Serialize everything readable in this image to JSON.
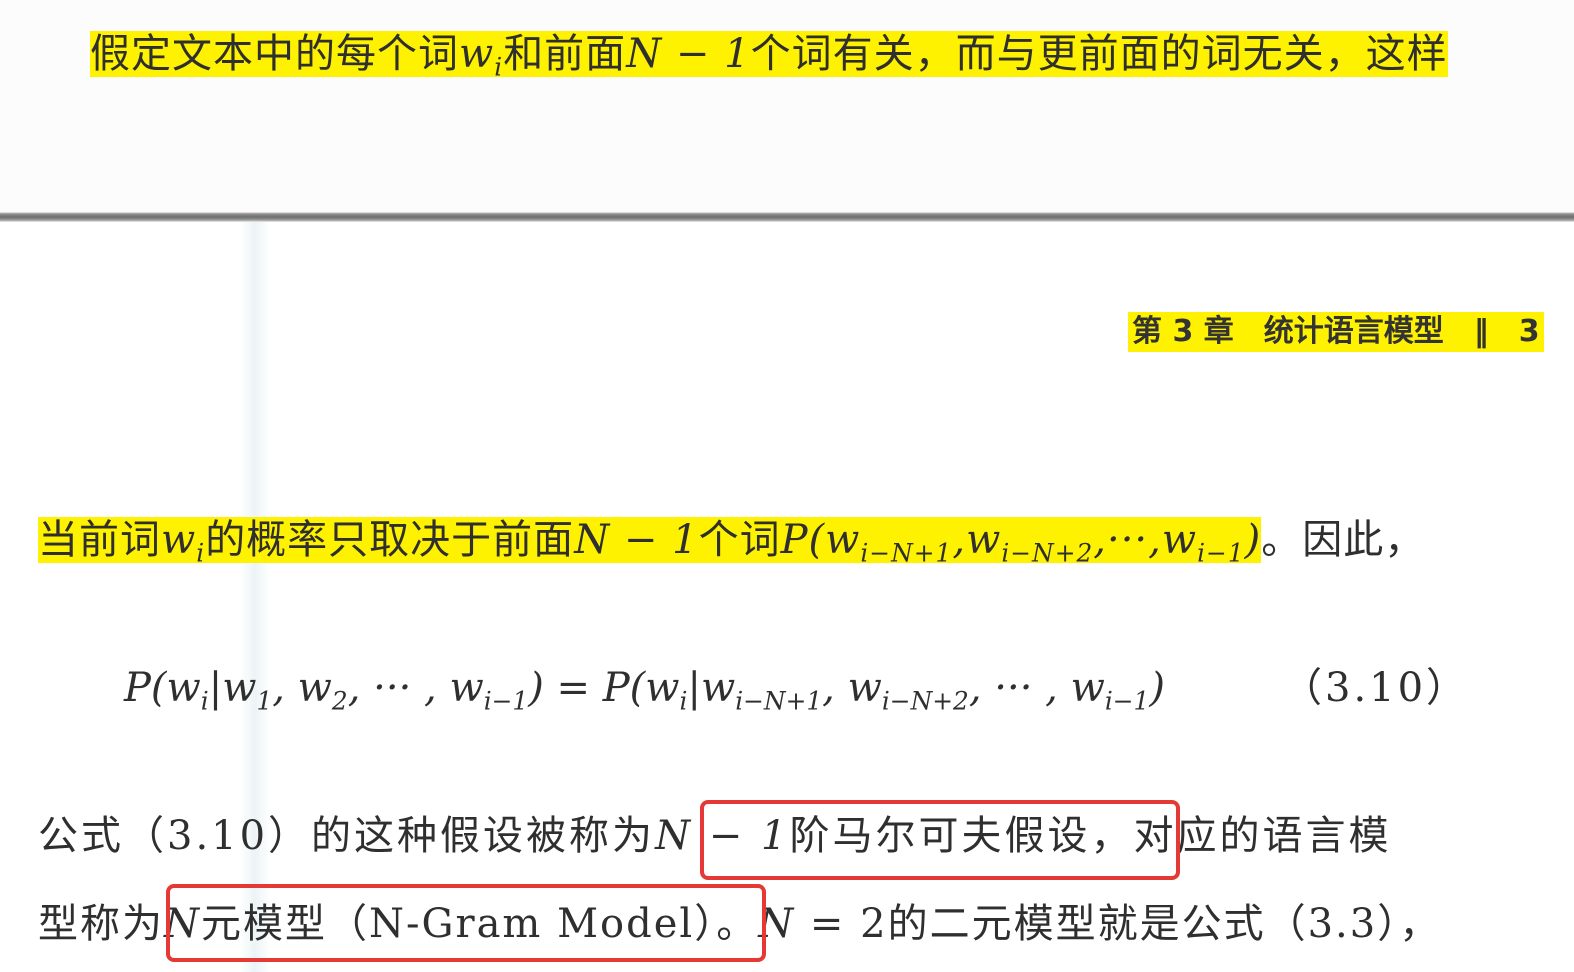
{
  "top_page": {
    "line_before": "假定文本中的每个词",
    "word": "w",
    "word_sub": "i",
    "line_after": "和前面",
    "n_expr": "N − 1",
    "line_tail": "个词有关，而与更前面的词无关，这样"
  },
  "running_header": {
    "text": "第 3 章　统计语言模型　‖　3"
  },
  "prob_line": {
    "before": "当前词",
    "word": "w",
    "word_sub": "i",
    "middle": "的概率只取决于前面",
    "n_expr": "N − 1",
    "after": "个词",
    "p": "P(",
    "w1": "w",
    "w1_sub": "i−N+1",
    "w2": "w",
    "w2_sub": "i−N+2",
    "dots": "···",
    "w3": "w",
    "w3_sub": "i−1",
    "close": ")",
    "tail": "。因此，"
  },
  "equation": {
    "lhs_open": "P(",
    "lhs_wi": "w",
    "lhs_wi_sub": "i",
    "bar": "|",
    "lhs_w1": "w",
    "lhs_w1_sub": "1",
    "lhs_w2": "w",
    "lhs_w2_sub": "2",
    "dots": "···",
    "lhs_wlast": "w",
    "lhs_wlast_sub": "i−1",
    "close": ")",
    "equals": " = ",
    "rhs_open": "P(",
    "rhs_wi": "w",
    "rhs_wi_sub": "i",
    "rhs_w1": "w",
    "rhs_w1_sub": "i−N+1",
    "rhs_w2": "w",
    "rhs_w2_sub": "i−N+2",
    "rhs_wlast": "w",
    "rhs_wlast_sub": "i−1",
    "number": "（3.10）"
  },
  "body": {
    "line1_before": "公式（3.10）的这种假设被称为",
    "line1_n": "N − 1",
    "line1_term": "阶马尔可夫假设",
    "line1_after": "，对应的语言模",
    "line2_before": "型称为",
    "line2_n": "N",
    "line2_term": "元模型（N-Gram Model）",
    "line2_mid": "。",
    "line2_n2": "N",
    "line2_eq": " = 2",
    "line2_after": "的二元模型就是公式（3.3），"
  },
  "colors": {
    "highlight": "#fff200",
    "annotation_box": "#e53935"
  }
}
